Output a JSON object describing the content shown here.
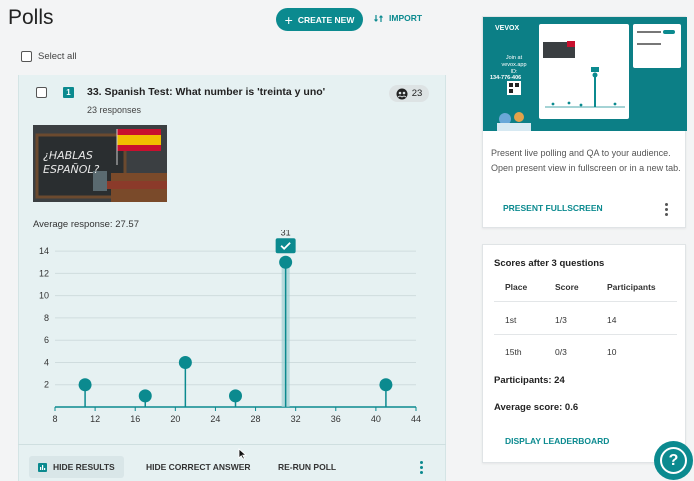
{
  "header": {
    "title": "Polls",
    "create_label": "CREATE NEW",
    "import_label": "IMPORT"
  },
  "select_all_label": "Select all",
  "poll": {
    "number": "1",
    "title": "33. Spanish Test: What number is 'treinta y uno'",
    "responses": "23 responses",
    "response_count": "23",
    "image_text": "¿HABLAS ESPAÑOL?",
    "average": "Average response: 27.57",
    "actions": {
      "hide_results": "HIDE RESULTS",
      "hide_correct": "HIDE CORRECT ANSWER",
      "rerun": "RE-RUN POLL"
    }
  },
  "chart_data": {
    "type": "scatter",
    "style": "lollipop",
    "x": [
      11,
      17,
      21,
      26,
      31,
      41
    ],
    "y": [
      2,
      1,
      4,
      1,
      13,
      2
    ],
    "highlight": {
      "x": 31,
      "label": "31",
      "correct": true
    },
    "x_ticks": [
      "8",
      "12",
      "16",
      "20",
      "24",
      "28",
      "32",
      "36",
      "40",
      "44"
    ],
    "y_ticks": [
      "2",
      "4",
      "6",
      "8",
      "10",
      "12",
      "14"
    ],
    "xlim": [
      8,
      44
    ],
    "ylim": [
      0,
      15
    ],
    "grid": true,
    "color": "#0b8a8f"
  },
  "present": {
    "description": "Present live polling and QA to your audience. Open present view in fullscreen or in a new tab.",
    "fullscreen_label": "PRESENT FULLSCREEN",
    "thumb": {
      "brand": "VEVOX",
      "join_text": "Join at",
      "join_url": "vevox.app",
      "id_label": "ID:",
      "id_value": "134-776-406"
    }
  },
  "scores": {
    "title": "Scores after 3 questions",
    "headers": [
      "Place",
      "Score",
      "Participants"
    ],
    "rows": [
      [
        "1st",
        "1/3",
        "14"
      ],
      [
        "15th",
        "0/3",
        "10"
      ]
    ],
    "participants": "Participants: 24",
    "average_score": "Average score: 0.6",
    "leaderboard_label": "DISPLAY LEADERBOARD"
  },
  "colors": {
    "accent": "#0b8a8f",
    "card_bg": "#e6f1f2"
  }
}
